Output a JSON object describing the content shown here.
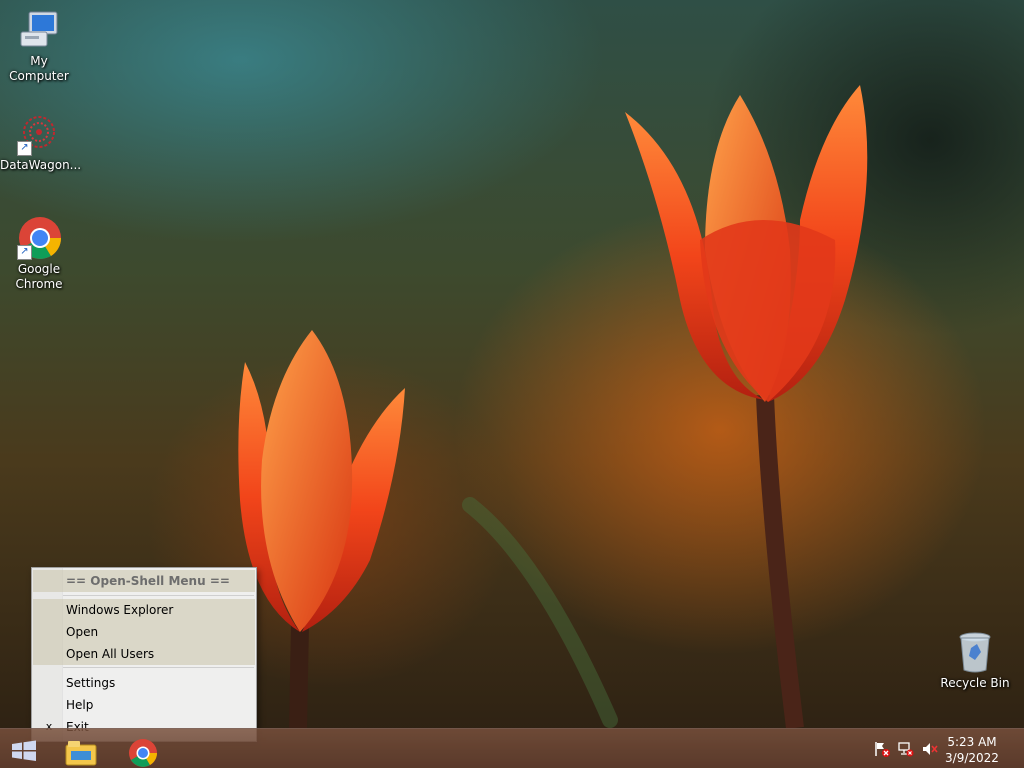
{
  "desktop": {
    "icons": [
      {
        "label": "My Computer",
        "icon": "computer-icon"
      },
      {
        "label": "DataWagon...",
        "icon": "datawagon-icon"
      },
      {
        "label": "Google Chrome",
        "icon": "chrome-icon"
      },
      {
        "label": "Recycle Bin",
        "icon": "recycle-bin-icon"
      }
    ]
  },
  "context_menu": {
    "title": "== Open-Shell Menu ==",
    "items": [
      {
        "label": "Windows Explorer"
      },
      {
        "label": "Open"
      },
      {
        "label": "Open All Users"
      },
      {
        "label": "Settings"
      },
      {
        "label": "Help"
      },
      {
        "label": "Exit",
        "check": "x"
      }
    ]
  },
  "taskbar": {
    "start_icon": "windows-logo-icon",
    "pinned": [
      {
        "icon": "file-explorer-icon"
      },
      {
        "icon": "chrome-icon"
      }
    ],
    "tray": [
      {
        "icon": "action-center-flag-icon"
      },
      {
        "icon": "network-icon"
      },
      {
        "icon": "volume-muted-icon"
      }
    ],
    "clock": {
      "time": "5:23 AM",
      "date": "3/9/2022"
    }
  },
  "colors": {
    "menu_bg": "#efefee",
    "menu_highlight": "#d6d2c0",
    "taskbar": "#6f4a38"
  }
}
